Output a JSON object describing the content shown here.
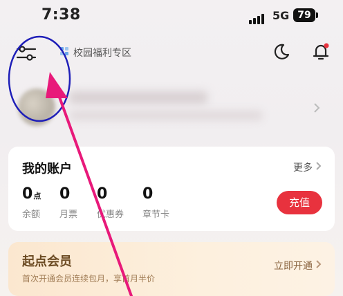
{
  "status_bar": {
    "time": "7:38",
    "network": "5G",
    "battery": "79"
  },
  "header": {
    "filter_icon": "sliders-icon",
    "campus_label": "校园福利专区",
    "theme_icon": "moon-icon",
    "notification_icon": "bell-icon"
  },
  "account": {
    "title": "我的账户",
    "more_label": "更多",
    "stats": [
      {
        "value": "0",
        "unit": "点",
        "label": "余额"
      },
      {
        "value": "0",
        "unit": "",
        "label": "月票"
      },
      {
        "value": "0",
        "unit": "",
        "label": "优惠券"
      },
      {
        "value": "0",
        "unit": "",
        "label": "章节卡"
      }
    ],
    "recharge_label": "充值"
  },
  "membership": {
    "title": "起点会员",
    "subtitle": "首次开通会员连续包月，享首月半价",
    "cta_label": "立即开通"
  },
  "colors": {
    "accent_red": "#e8323e",
    "annotation_pink": "#e8197a",
    "annotation_blue": "#1f1fb8"
  }
}
